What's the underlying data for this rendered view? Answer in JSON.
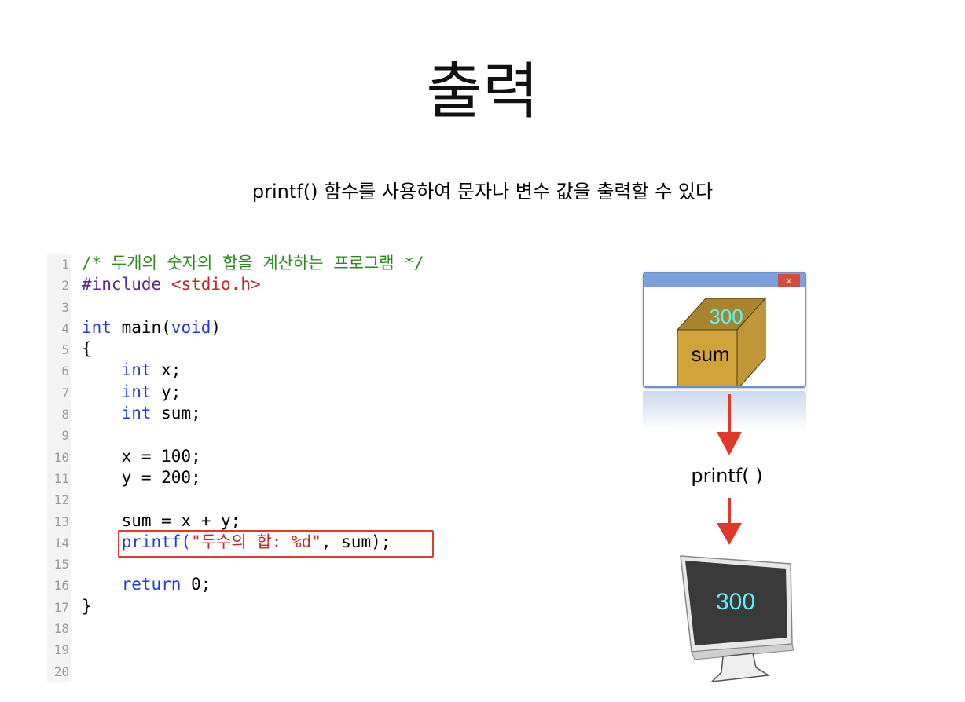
{
  "slide": {
    "title": "출력",
    "subtitle": "printf() 함수를 사용하여 문자나 변수 값을 출력할 수 있다"
  },
  "code": {
    "line_numbers": [
      "1",
      "2",
      "3",
      "4",
      "5",
      "6",
      "7",
      "8",
      "9",
      "10",
      "11",
      "12",
      "13",
      "14",
      "15",
      "16",
      "17",
      "18",
      "19",
      "20"
    ],
    "l1_comment": "/* 두개의 숫자의 합을 계산하는 프로그램 */",
    "l2_directive": "#include",
    "l2_header": "<stdio.h>",
    "l4_type": "int",
    "l4_main": " main(",
    "l4_void": "void",
    "l4_close": ")",
    "l5_brace": "{",
    "l6_type": "int",
    "l6_rest": " x;",
    "l7_type": "int",
    "l7_rest": " y;",
    "l8_type": "int",
    "l8_rest": " sum;",
    "l10": "x = 100;",
    "l11": "y = 200;",
    "l13": "sum = x + y;",
    "l14_func": "printf(",
    "l14_string": "\"두수의 합: %d\"",
    "l14_rest": ", sum);",
    "l16_kw": "return",
    "l16_rest": " 0;",
    "l17_brace": "}"
  },
  "diagram": {
    "window_close": "x",
    "box_value": "300",
    "box_label": "sum",
    "arrow_label": "printf( )",
    "monitor_value": "300",
    "colors": {
      "box_face": "#d0a43b",
      "box_inner": "#a8852c",
      "value_text": "#5ef0ff",
      "arrow": "#e0392b",
      "highlight": "#e23a2a"
    }
  }
}
